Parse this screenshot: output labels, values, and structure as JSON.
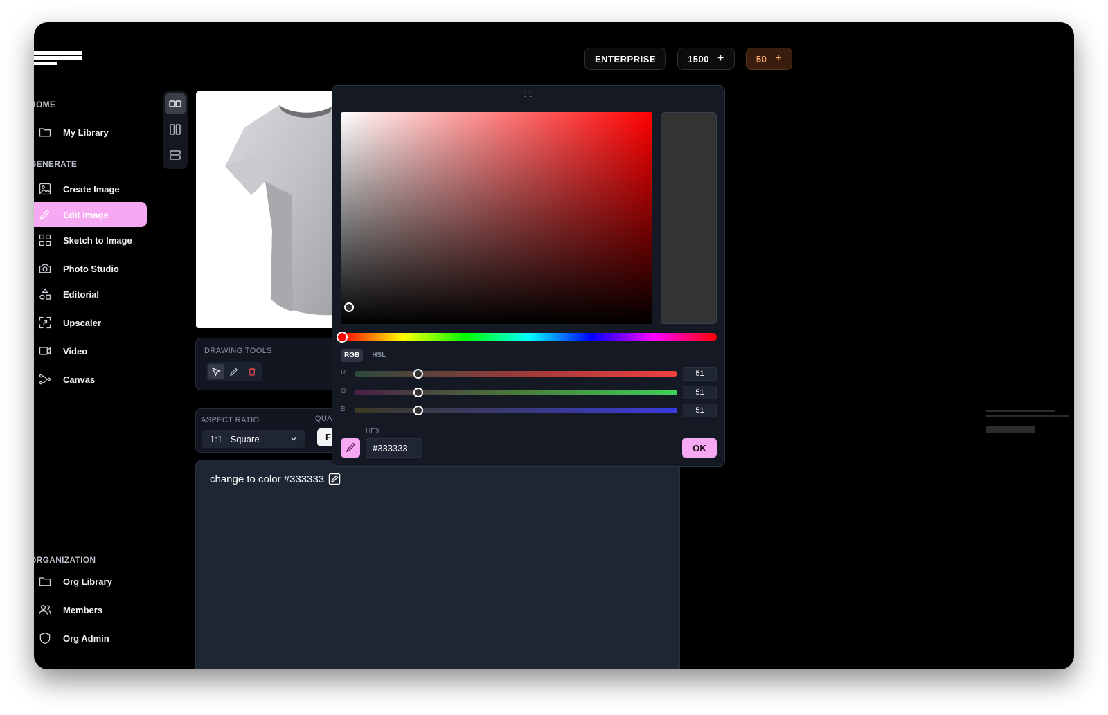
{
  "topbar": {
    "plan": "ENTERPRISE",
    "credits_primary": "1500",
    "credits_secondary": "50",
    "plus": "+"
  },
  "sidebar": {
    "home_label": "HOME",
    "my_library": "My Library",
    "generate_label": "GENERATE",
    "items": [
      {
        "label": "Create Image",
        "icon": "image-icon"
      },
      {
        "label": "Edit Image",
        "icon": "pencil-icon",
        "active": true
      },
      {
        "label": "Sketch to Image",
        "icon": "grid-icon"
      },
      {
        "label": "Photo Studio",
        "icon": "camera-icon"
      },
      {
        "label": "Editorial",
        "icon": "shapes-icon"
      },
      {
        "label": "Upscaler",
        "icon": "upscale-icon"
      },
      {
        "label": "Video",
        "icon": "video-icon"
      },
      {
        "label": "Canvas",
        "icon": "canvas-icon"
      }
    ],
    "organization_label": "ORGANIZATION",
    "org_items": [
      {
        "label": "Org Library",
        "icon": "folder-icon"
      },
      {
        "label": "Members",
        "icon": "users-icon"
      },
      {
        "label": "Org Admin",
        "icon": "shield-icon"
      }
    ],
    "accent_color": "#f7a8f2"
  },
  "tools": {
    "label": "DRAWING TOOLS"
  },
  "aspect": {
    "label": "ASPECT RATIO",
    "value": "1:1 - Square",
    "quality_label_fragment": "QUA",
    "quality_button_fragment": "F"
  },
  "prompt": {
    "text": "change to color #333333"
  },
  "color_picker": {
    "drag_handle": ":::",
    "modes": [
      "RGB",
      "HSL"
    ],
    "active_mode": "RGB",
    "channels": [
      {
        "label": "R",
        "value": "51"
      },
      {
        "label": "G",
        "value": "51"
      },
      {
        "label": "B",
        "value": "51"
      }
    ],
    "hex_label": "HEX",
    "hex_value": "#333333",
    "ok_label": "OK",
    "selected_color": "#333333",
    "hue": 0
  }
}
